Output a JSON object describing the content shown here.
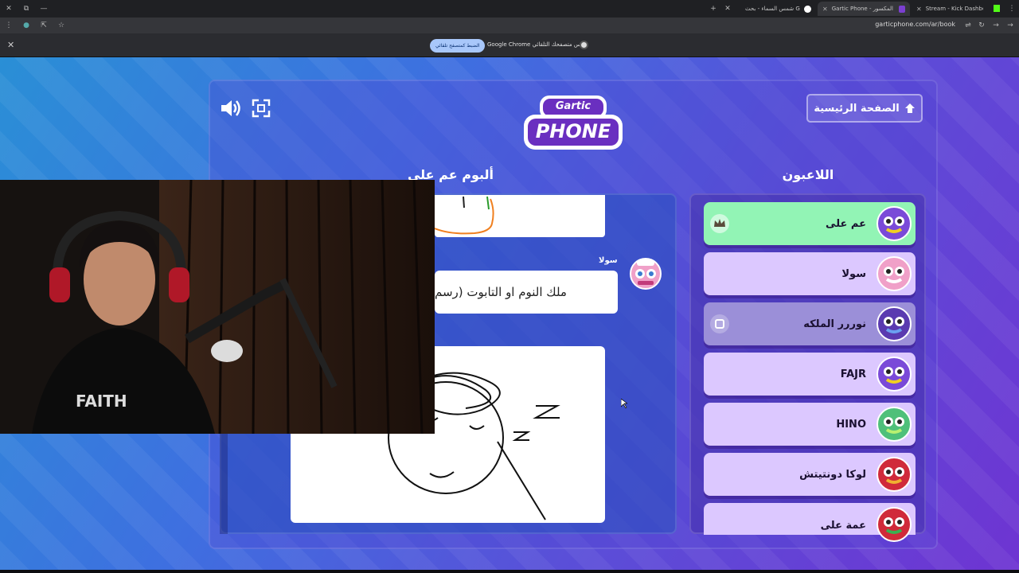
{
  "browser": {
    "tabs": [
      {
        "title": "شمس السماء - بحث Google",
        "active": false
      },
      {
        "title": "Gartic Phone - الهاتف المكسور",
        "active": true
      },
      {
        "title": "Stream - Kick Dashboard",
        "active": false
      }
    ],
    "url": "garticphone.com/ar/book",
    "infobar": {
      "message": "Google Chrome ليس متصفحك التلقائي.",
      "button": "الضبط كمتصفح تلقائي"
    }
  },
  "game": {
    "logo_line1": "Gartic",
    "logo_line2": "PHONE",
    "home_button": "الصفحة الرئيسية",
    "players_title": "اللاعبون",
    "album_title": "ألبوم عم علي",
    "players": [
      {
        "name": "عم على",
        "host": true
      },
      {
        "name": "سولا",
        "host": false
      },
      {
        "name": "نوررر الملكه",
        "host": false,
        "away": true
      },
      {
        "name": "FAJR",
        "host": false
      },
      {
        "name": "HINO",
        "host": false
      },
      {
        "name": "لوكا دونتيتش",
        "host": false
      },
      {
        "name": "عمة على",
        "host": false
      }
    ],
    "album": {
      "author": "سولا",
      "phrase": "ملك النوم او التابوت (رسم"
    }
  },
  "colors": {
    "host_bg": "#92f4b5",
    "player_bg": "#dcc8ff",
    "away_bg": "#9b8fd8"
  }
}
